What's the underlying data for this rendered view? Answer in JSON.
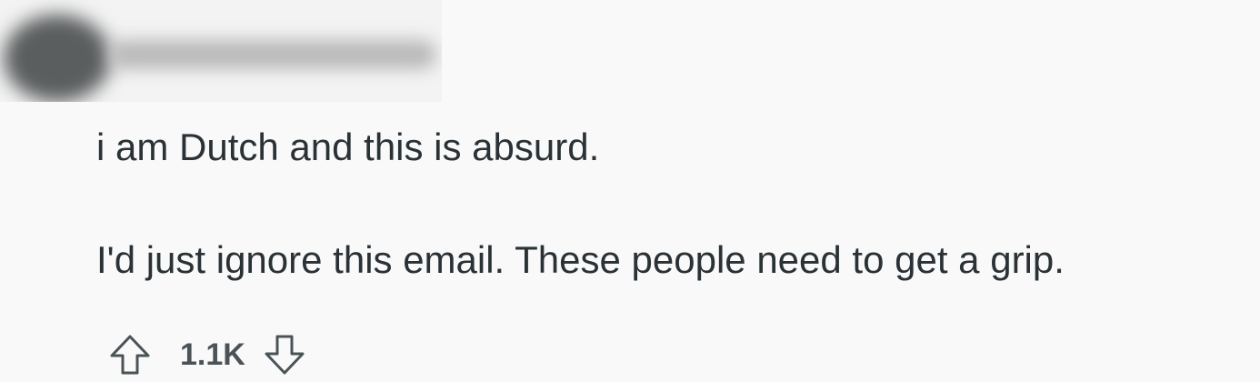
{
  "comment": {
    "body_lines": [
      "i am Dutch and this is absurd.",
      "I'd just ignore this email. These people need to get a grip."
    ],
    "score": "1.1K"
  },
  "icons": {
    "upvote": "arrow-up-outline-icon",
    "downvote": "arrow-down-outline-icon"
  },
  "colors": {
    "background": "#f9f9fa",
    "text": "#2a3236",
    "action_text": "#4b5357"
  }
}
